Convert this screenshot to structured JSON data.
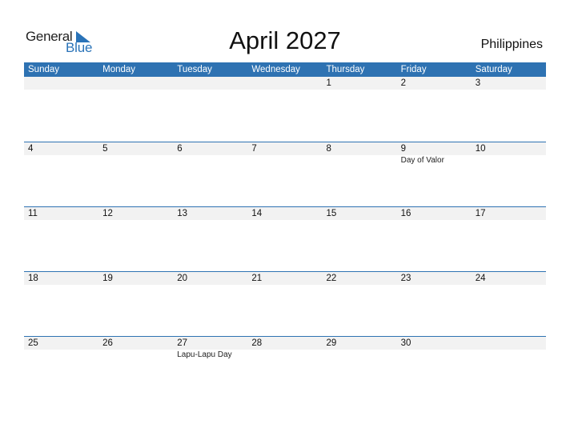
{
  "logo": {
    "part1": "General",
    "part2": "Blue"
  },
  "title": "April 2027",
  "country": "Philippines",
  "weekdays": [
    "Sunday",
    "Monday",
    "Tuesday",
    "Wednesday",
    "Thursday",
    "Friday",
    "Saturday"
  ],
  "weeks": [
    {
      "days": [
        "",
        "",
        "",
        "",
        "1",
        "2",
        "3"
      ],
      "events": [
        "",
        "",
        "",
        "",
        "",
        "",
        ""
      ]
    },
    {
      "days": [
        "4",
        "5",
        "6",
        "7",
        "8",
        "9",
        "10"
      ],
      "events": [
        "",
        "",
        "",
        "",
        "",
        "Day of Valor",
        ""
      ]
    },
    {
      "days": [
        "11",
        "12",
        "13",
        "14",
        "15",
        "16",
        "17"
      ],
      "events": [
        "",
        "",
        "",
        "",
        "",
        "",
        ""
      ]
    },
    {
      "days": [
        "18",
        "19",
        "20",
        "21",
        "22",
        "23",
        "24"
      ],
      "events": [
        "",
        "",
        "",
        "",
        "",
        "",
        ""
      ]
    },
    {
      "days": [
        "25",
        "26",
        "27",
        "28",
        "29",
        "30",
        ""
      ],
      "events": [
        "",
        "",
        "Lapu-Lapu Day",
        "",
        "",
        "",
        ""
      ]
    }
  ],
  "colors": {
    "accent": "#2e72b2",
    "day_band": "#f2f2f2"
  }
}
